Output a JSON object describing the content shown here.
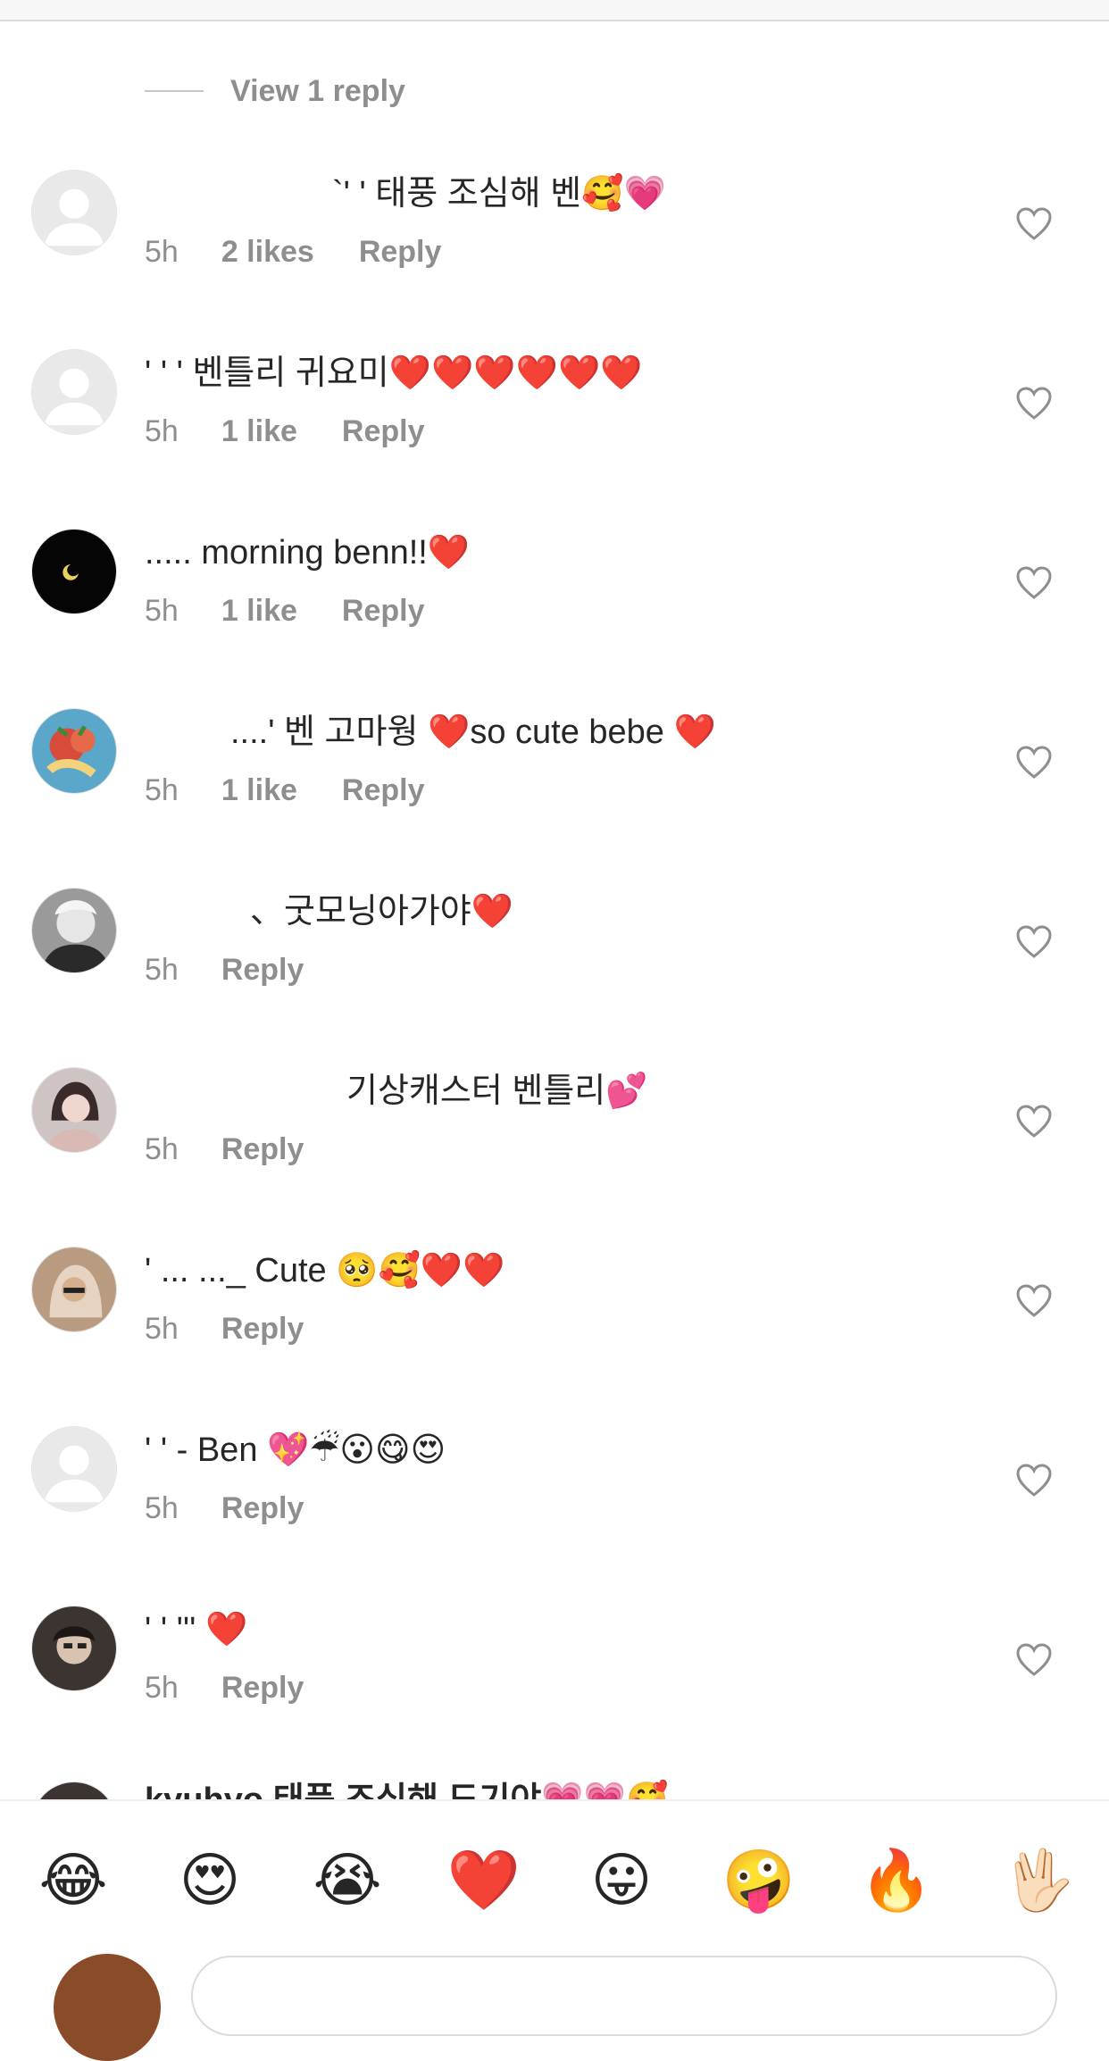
{
  "view_replies_label": "View 1 reply",
  "comments": [
    {
      "text": "`' ' 태풍 조심해 벤🥰💗",
      "time": "5h",
      "likes": "2 likes",
      "reply": "Reply",
      "avatar": "default"
    },
    {
      "text": "' ' ' 벤틀리 귀요미❤️❤️❤️❤️❤️❤️",
      "time": "5h",
      "likes": "1 like",
      "reply": "Reply",
      "avatar": "default"
    },
    {
      "text": "..... morning benn!!❤️",
      "time": "5h",
      "likes": "1 like",
      "reply": "Reply",
      "avatar": "moon"
    },
    {
      "text": "....' 벤 고마웡 ❤️so cute bebe ❤️",
      "time": "5h",
      "likes": "1 like",
      "reply": "Reply",
      "avatar": "painting"
    },
    {
      "text": "、굿모닝아가야❤️",
      "time": "5h",
      "likes": "",
      "reply": "Reply",
      "avatar": "bw-portrait"
    },
    {
      "text": "기상캐스터 벤틀리💕",
      "time": "5h",
      "likes": "",
      "reply": "Reply",
      "avatar": "girl"
    },
    {
      "text": "' ... ..._ Cute 🥺🥰❤️❤️",
      "time": "5h",
      "likes": "",
      "reply": "Reply",
      "avatar": "hijab"
    },
    {
      "text": "' ' - Ben 💖☔😮😋😍",
      "time": "5h",
      "likes": "",
      "reply": "Reply",
      "avatar": "default"
    },
    {
      "text": "' ' ''' ❤️",
      "time": "5h",
      "likes": "",
      "reply": "Reply",
      "avatar": "dark-portrait"
    }
  ],
  "partial_comment": {
    "text": "kyuhyo 태풍 조심해 도기야💗💗🥰"
  },
  "emoji_bar": [
    "😂",
    "😍",
    "😭",
    "❤️",
    "😛",
    "🤪",
    "🔥",
    "🖖🏻"
  ],
  "colors": {
    "secondary_text": "#8e8e8e",
    "primary_text": "#262626",
    "divider": "#dbdbdb"
  }
}
